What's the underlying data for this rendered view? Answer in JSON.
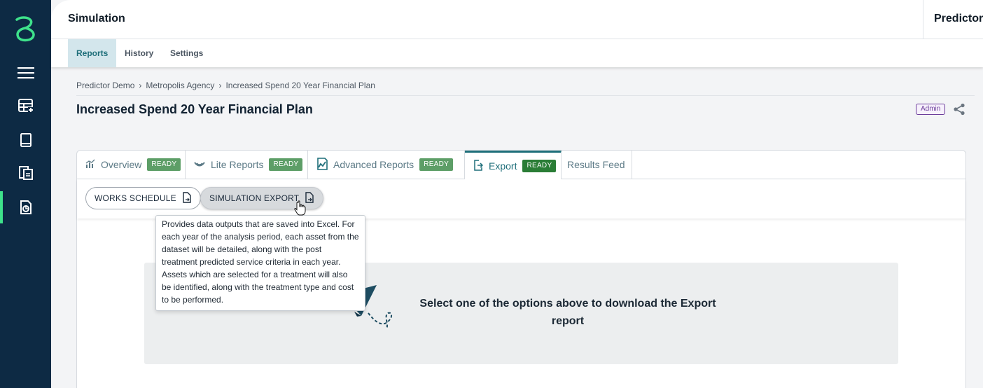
{
  "header": {
    "title": "Simulation",
    "right_title": "Predictor"
  },
  "subnav": {
    "items": [
      {
        "label": "Reports",
        "active": true
      },
      {
        "label": "History",
        "active": false
      },
      {
        "label": "Settings",
        "active": false
      }
    ]
  },
  "breadcrumb": [
    "Predictor Demo",
    "Metropolis Agency",
    "Increased Spend 20 Year Financial Plan"
  ],
  "page": {
    "title": "Increased Spend 20 Year Financial Plan",
    "badge": "Admin"
  },
  "tabs": [
    {
      "label": "Overview",
      "status": "READY",
      "icon": "chart-icon"
    },
    {
      "label": "Lite Reports",
      "status": "READY",
      "icon": "lite-reports-icon"
    },
    {
      "label": "Advanced Reports",
      "status": "READY",
      "icon": "advanced-reports-icon"
    },
    {
      "label": "Export",
      "status": "READY",
      "icon": "export-icon",
      "active": true
    },
    {
      "label": "Results Feed",
      "status": "",
      "icon": ""
    }
  ],
  "export_options": [
    {
      "label": "WORKS SCHEDULE",
      "icon": "document-icon"
    },
    {
      "label": "SIMULATION EXPORT",
      "icon": "document-icon",
      "hovered": true
    }
  ],
  "tooltip": {
    "text": "Provides data outputs that are saved into Excel. For each year of the analysis period, each asset from the dataset will be detailed, along with the post treatment predicted service criteria in each year. Assets which are selected for a treatment will also be identified, along with the treatment type and cost to be performed."
  },
  "empty_state": {
    "message": "Select one of the options above to download the Export report"
  },
  "colors": {
    "rail": "#0d2a44",
    "accent": "#3ee28b",
    "teal": "#1f6f7a",
    "ready": "#5d9e67",
    "ready_active": "#2a7d36",
    "admin": "#6c3d9b"
  }
}
